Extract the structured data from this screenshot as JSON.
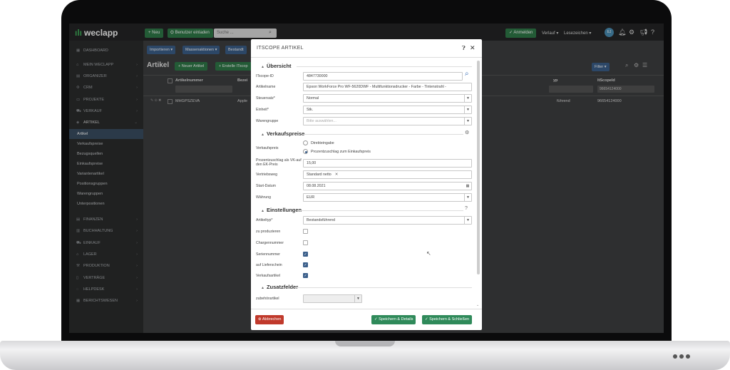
{
  "topbar": {
    "logo": "weclapp",
    "new_button": "+ Neu",
    "invite_button": "Benutzer einladen",
    "search_placeholder": "Suche ...",
    "login_button": "✓ Anmelden",
    "history_link": "Verlauf ▾",
    "bookmarks_link": "Lesezeichen ▾",
    "avatar_initials": "EJ"
  },
  "sidebar": {
    "items": [
      {
        "label": "DASHBOARD",
        "icon": "dashboard-icon"
      },
      {
        "label": "MEIN WECLAPP",
        "icon": "home-icon"
      },
      {
        "label": "ORGANIZER",
        "icon": "calendar-icon"
      },
      {
        "label": "CRM",
        "icon": "crm-icon"
      },
      {
        "label": "PROJEKTE",
        "icon": "folder-icon"
      },
      {
        "label": "VERKAUF",
        "icon": "cart-icon"
      },
      {
        "label": "ARTIKEL",
        "icon": "tag-icon"
      }
    ],
    "sub_items": [
      "Artikel",
      "Verkaufspreise",
      "Bezugsquellen",
      "Einkaufspreise",
      "Variantenartikel",
      "Positionsgruppen",
      "Warengruppen",
      "Unterpositionen"
    ],
    "bottom_items": [
      {
        "label": "FINANZEN",
        "icon": "finance-icon"
      },
      {
        "label": "BUCHHALTUNG",
        "icon": "ledger-icon"
      },
      {
        "label": "EINKAUF",
        "icon": "purchase-icon"
      },
      {
        "label": "LAGER",
        "icon": "warehouse-icon"
      },
      {
        "label": "PRODUKTION",
        "icon": "production-icon"
      },
      {
        "label": "VERTRÄGE",
        "icon": "contract-icon"
      },
      {
        "label": "HELPDESK",
        "icon": "helpdesk-icon"
      },
      {
        "label": "BERICHTSWESEN",
        "icon": "report-icon"
      }
    ]
  },
  "main": {
    "toolbar": [
      "Importieren ▾",
      "Massenaktionen ▾",
      "Bestandt"
    ],
    "title": "Artikel",
    "new_article_button": "+ Neuer Artikel",
    "create_itscope_button": "+ Erstelle ITscop",
    "filter_button": "Filter ▾",
    "columns": [
      "Artikelnummer",
      "Bezei",
      "yp",
      "ItScopeId"
    ],
    "filter_value": "96654124000",
    "row": {
      "article_number": "MHGPSZEVA",
      "name": "Apple",
      "type": "führend",
      "itscope_id": "96654124000"
    }
  },
  "modal": {
    "title": "ITSCOPE ARTIKEL",
    "sections": {
      "overview": "Übersicht",
      "sales_prices": "Verkaufspreise",
      "settings": "Einstellungen",
      "extra_fields": "Zusatzfelder"
    },
    "fields": {
      "itscope_id_label": "ITscope-ID",
      "itscope_id_value": "4847730000",
      "article_name_label": "Artikelname",
      "article_name_value": "Epson WorkForce Pro WF-5620DWF - Multifunktionsdrucker - Farbe - Tintenstrahl -",
      "tax_label": "Steuersatz*",
      "tax_value": "Normal",
      "unit_label": "Einheit*",
      "unit_value": "Stk.",
      "group_label": "Warengruppe",
      "group_placeholder": "Bitte auswählen...",
      "sales_price_label": "Verkaufspreis",
      "radio_direct": "Direkteingabe",
      "radio_markup": "Prozentzuschlag zum Einkaufspreis",
      "markup_label": "Prozentzuschlag als VK-auf den EK-Preis",
      "markup_value": "15,00",
      "channel_label": "Vertriebsweg",
      "channel_value": "Standard netto",
      "start_date_label": "Start-Datum",
      "start_date_value": "08.08.2021",
      "currency_label": "Währung",
      "currency_value": "EUR",
      "article_type_label": "Artikeltyp*",
      "article_type_value": "Bestandsführend",
      "produce_label": "zu produzieren",
      "batch_label": "Chargennummer",
      "serial_label": "Seriennummer",
      "delivery_label": "auf Lieferschein",
      "sales_article_label": "Verkaufsartikel",
      "accessory_label": "zubehörartikel"
    },
    "checkboxes": {
      "produce": false,
      "batch": false,
      "serial": true,
      "delivery": true,
      "sales_article": true
    },
    "buttons": {
      "cancel": "Abbrechen",
      "save_details": "Speichern & Details",
      "save_close": "Speichern & Schließen"
    }
  }
}
